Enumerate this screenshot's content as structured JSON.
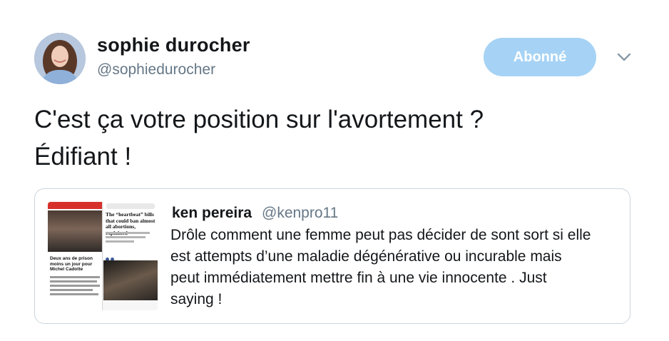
{
  "author": {
    "display_name": "sophie durocher",
    "handle": "@sophiedurocher",
    "avatar_icon": "profile-photo"
  },
  "follow_button": {
    "label": "Abonné",
    "color": "#a6d3f5"
  },
  "more_icon": "chevron-down-icon",
  "tweet_text": {
    "lines": [
      "C'est ça votre position sur l'avortement ?",
      "Édifiant !"
    ]
  },
  "quoted_tweet": {
    "display_name": "ken pereira",
    "handle": "@kenpro11",
    "text_lines": [
      "Drôle comment une femme peut pas décider de sont sort si elle",
      "est attempts d’une maladie dégénérative ou incurable mais",
      "peut immédiatement mettre fin à une vie innocente .  Just",
      "saying !"
    ],
    "media": {
      "left_headline": "Deux ans de prison moins un jour pour Michel Cadotte",
      "right_headline": "The “heartbeat” bills that could ban almost all abortions, explained"
    }
  },
  "colors": {
    "text": "#14171a",
    "secondary": "#657786",
    "border": "#ccd6dd"
  }
}
